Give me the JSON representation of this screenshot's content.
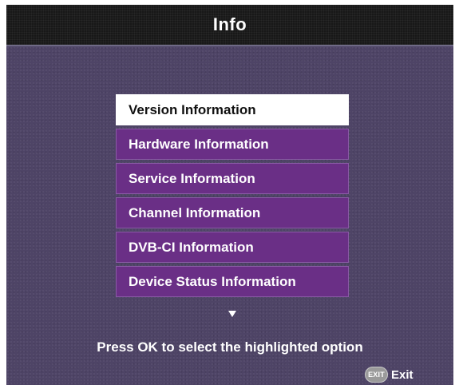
{
  "title": "Info",
  "menu": {
    "items": [
      {
        "label": "Version Information",
        "selected": true
      },
      {
        "label": "Hardware Information",
        "selected": false
      },
      {
        "label": "Service Information",
        "selected": false
      },
      {
        "label": "Channel Information",
        "selected": false
      },
      {
        "label": "DVB-CI Information",
        "selected": false
      },
      {
        "label": "Device Status Information",
        "selected": false
      }
    ],
    "more_indicator_icon": "down-triangle-icon"
  },
  "hint": "Press OK to select the highlighted option",
  "exit": {
    "badge": "EXIT",
    "label": "Exit"
  },
  "colors": {
    "background": "#4e4466",
    "title_bar": "#181818",
    "menu_item": "#6a2f86",
    "menu_item_selected": "#ffffff"
  }
}
